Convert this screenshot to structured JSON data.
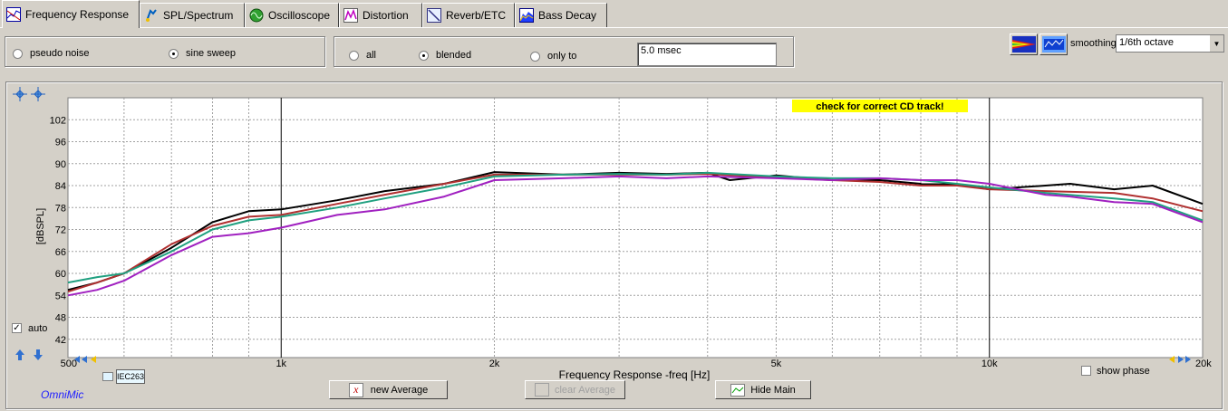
{
  "tabs": [
    {
      "label": "Frequency Response",
      "icon": "frequency-response-icon",
      "active": true
    },
    {
      "label": "SPL/Spectrum",
      "icon": "spl-spectrum-icon",
      "active": false
    },
    {
      "label": "Oscilloscope",
      "icon": "oscilloscope-icon",
      "active": false
    },
    {
      "label": "Distortion",
      "icon": "distortion-icon",
      "active": false
    },
    {
      "label": "Reverb/ETC",
      "icon": "reverb-etc-icon",
      "active": false
    },
    {
      "label": "Bass Decay",
      "icon": "bass-decay-icon",
      "active": false
    }
  ],
  "signal": {
    "pseudo_noise": "pseudo noise",
    "sine_sweep": "sine sweep",
    "selected": "sine sweep"
  },
  "gating": {
    "all": "all",
    "blended": "blended",
    "only_to": "only to",
    "selected": "blended",
    "gate_time": "5.0 msec"
  },
  "smoothing": {
    "label": "smoothing",
    "value": "1/6th octave"
  },
  "chart": {
    "warning": "check for correct CD track!",
    "ylabel": "[dBSPL]",
    "xlabel": "Frequency Response -freq [Hz]",
    "auto_label": "auto",
    "show_phase_label": "show phase",
    "mic_chip": "IEC263",
    "brand": "OmniMic"
  },
  "buttons": {
    "new_average": "new Average",
    "clear_average": "clear Average",
    "hide_main": "Hide Main"
  },
  "chart_data": {
    "type": "line",
    "xlabel": "Frequency Response -freq [Hz]",
    "ylabel": "[dBSPL]",
    "xscale": "log",
    "xlim": [
      500,
      20000
    ],
    "ylim": [
      37,
      108
    ],
    "x_ticks": [
      500,
      1000,
      2000,
      5000,
      10000,
      20000
    ],
    "x_tick_labels": [
      "500",
      "1k",
      "2k",
      "5k",
      "10k",
      "20k"
    ],
    "y_ticks": [
      42,
      48,
      54,
      60,
      66,
      72,
      78,
      84,
      90,
      96,
      102
    ],
    "grid": true,
    "series": [
      {
        "color": "#000000",
        "x": [
          500,
          550,
          600,
          700,
          800,
          900,
          1000,
          1200,
          1400,
          1700,
          2000,
          2500,
          3000,
          3500,
          4000,
          4300,
          5000,
          6000,
          7000,
          8000,
          9000,
          10000,
          12000,
          13000,
          15000,
          17000,
          20000
        ],
        "y": [
          55.5,
          57.5,
          60,
          67,
          74,
          77,
          77.5,
          80,
          82.5,
          84.5,
          87.7,
          87,
          87.5,
          87.2,
          87.5,
          85.5,
          86.8,
          85.5,
          85.5,
          84.5,
          84.3,
          83,
          84,
          84.5,
          83,
          84,
          79
        ]
      },
      {
        "color": "#b03030",
        "x": [
          500,
          550,
          600,
          700,
          800,
          900,
          1000,
          1200,
          1400,
          1700,
          2000,
          2500,
          3000,
          3500,
          4000,
          5000,
          6000,
          7000,
          8000,
          9000,
          10000,
          12000,
          15000,
          17000,
          20000
        ],
        "y": [
          55,
          57.5,
          60,
          68,
          73,
          75.5,
          76,
          79,
          81.5,
          84.5,
          87,
          87,
          87,
          87,
          87.2,
          86.2,
          85.5,
          85,
          84,
          84,
          83,
          82.5,
          82,
          80.5,
          77
        ]
      },
      {
        "color": "#20a080",
        "x": [
          500,
          550,
          600,
          700,
          800,
          900,
          1000,
          1200,
          1400,
          1700,
          2000,
          2500,
          3000,
          3500,
          4000,
          5000,
          6000,
          7000,
          8000,
          9000,
          10000,
          12000,
          15000,
          17000,
          20000
        ],
        "y": [
          57.5,
          59,
          60,
          66,
          72,
          74.5,
          75.5,
          78,
          80.5,
          83.5,
          86.5,
          87,
          87.2,
          87,
          87.5,
          86.5,
          86,
          86,
          85.5,
          84.5,
          83.5,
          82,
          80.5,
          79.5,
          74.5
        ]
      },
      {
        "color": "#a020c0",
        "x": [
          500,
          550,
          600,
          700,
          800,
          900,
          1000,
          1200,
          1400,
          1700,
          2000,
          2500,
          3000,
          3500,
          4000,
          5000,
          6000,
          7000,
          8000,
          9000,
          10000,
          12000,
          13000,
          15000,
          17000,
          20000
        ],
        "y": [
          54,
          55.5,
          58,
          65,
          70,
          71,
          72.5,
          76,
          77.5,
          81,
          85.5,
          86,
          86.5,
          86,
          86.5,
          86,
          85.5,
          86,
          85.5,
          85.5,
          84.5,
          81.5,
          81,
          79.5,
          79,
          74
        ]
      }
    ]
  }
}
